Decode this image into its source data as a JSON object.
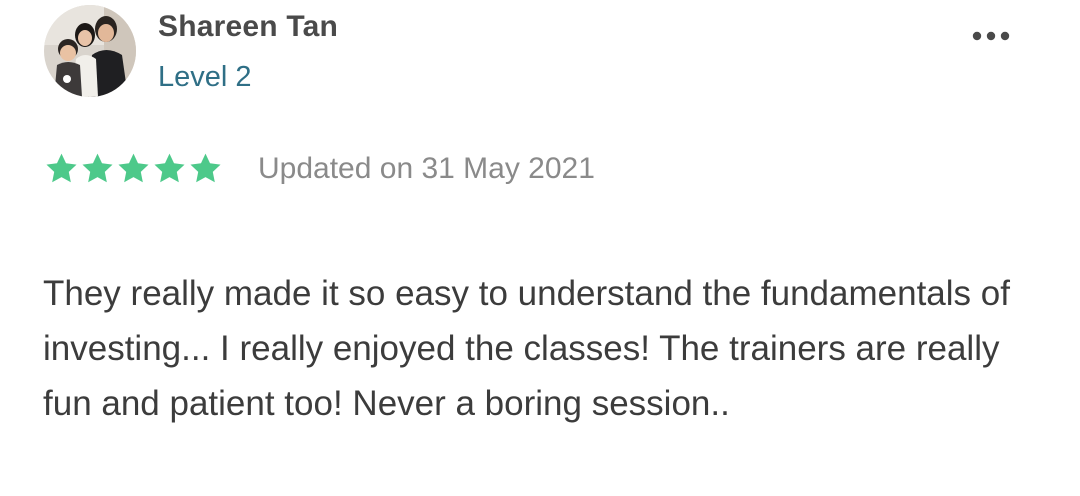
{
  "reviewer": {
    "name": "Shareen Tan",
    "level": "Level 2",
    "avatar_icon": "user-photo-avatar"
  },
  "menu": {
    "icon": "more-horizontal-icon"
  },
  "rating": {
    "stars_filled": 5,
    "stars_total": 5,
    "star_color": "#4dc98a",
    "updated_text": "Updated on 31 May 2021"
  },
  "review": {
    "text": "They really made it so easy to understand the fundamentals of investing... I really enjoyed the classes! The trainers are really fun and patient too! Never a boring session.."
  },
  "colors": {
    "name": "#4a4a4a",
    "level": "#2f6f86",
    "meta": "#8a8a8a",
    "body": "#3c3c3c"
  }
}
